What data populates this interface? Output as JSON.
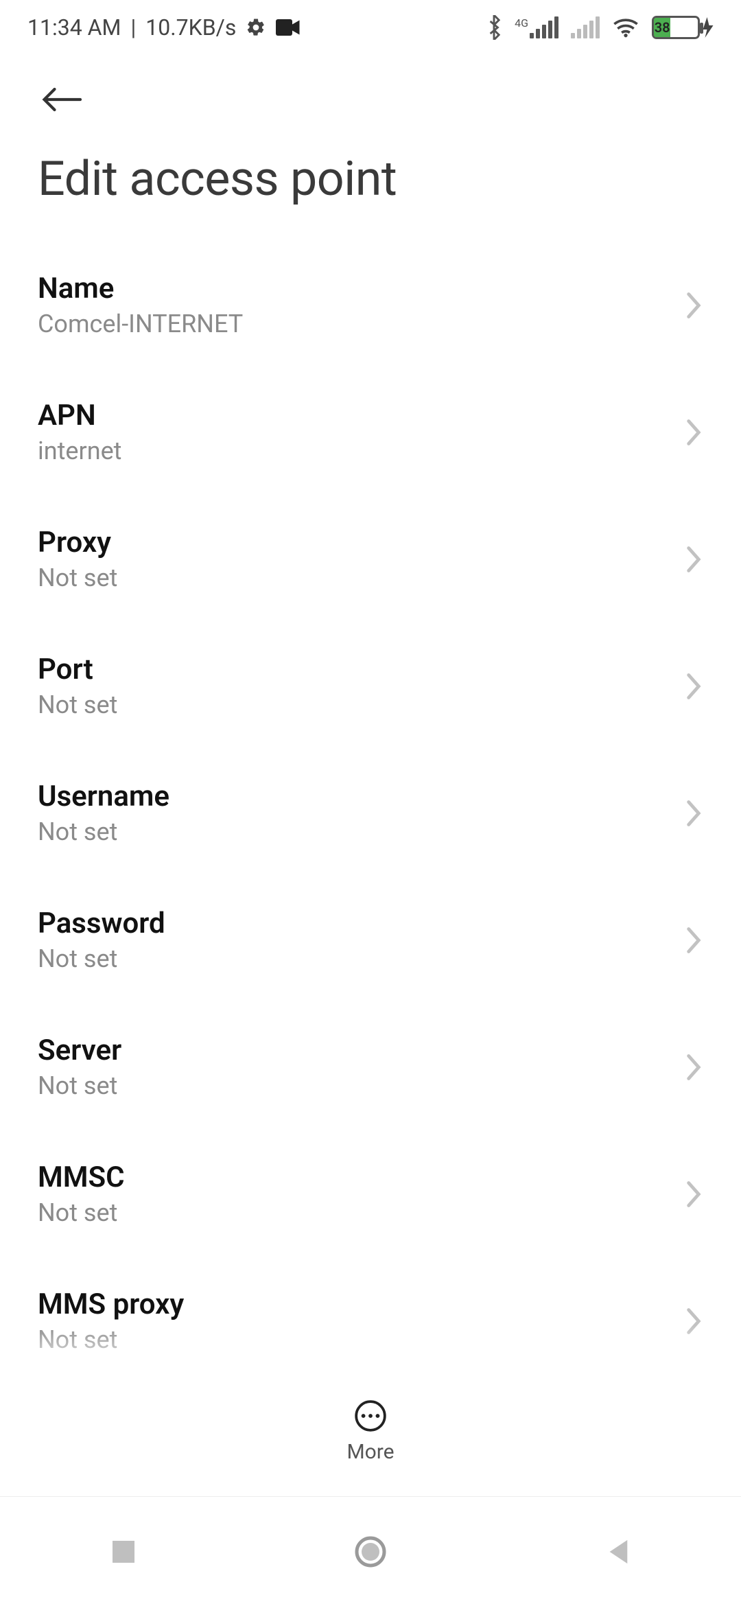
{
  "status": {
    "time": "11:34 AM",
    "net_speed": "10.7KB/s",
    "battery_pct": 38,
    "network_tag": "4G"
  },
  "page": {
    "title": "Edit access point"
  },
  "rows": [
    {
      "label": "Name",
      "value": "Comcel-INTERNET"
    },
    {
      "label": "APN",
      "value": "internet"
    },
    {
      "label": "Proxy",
      "value": "Not set"
    },
    {
      "label": "Port",
      "value": "Not set"
    },
    {
      "label": "Username",
      "value": "Not set"
    },
    {
      "label": "Password",
      "value": "Not set"
    },
    {
      "label": "Server",
      "value": "Not set"
    },
    {
      "label": "MMSC",
      "value": "Not set"
    },
    {
      "label": "MMS proxy",
      "value": "Not set"
    }
  ],
  "toolbar": {
    "more_label": "More"
  }
}
